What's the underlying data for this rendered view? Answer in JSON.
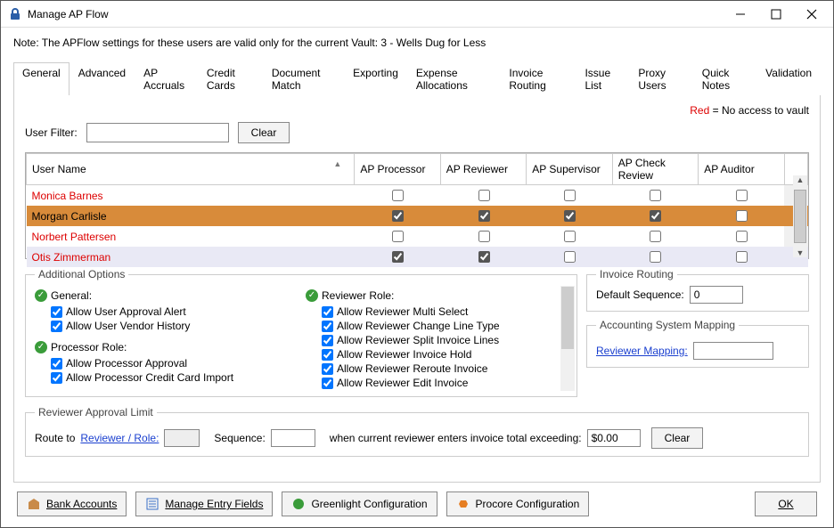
{
  "window": {
    "title": "Manage AP Flow"
  },
  "note": "Note:  The APFlow settings for these users are valid only for the current Vault: 3 - Wells Dug for Less",
  "redNote": {
    "red": "Red",
    "rest": " = No access to vault"
  },
  "tabs": [
    "General",
    "Advanced",
    "AP Accruals",
    "Credit Cards",
    "Document Match",
    "Exporting",
    "Expense Allocations",
    "Invoice Routing",
    "Issue List",
    "Proxy Users",
    "Quick Notes",
    "Validation"
  ],
  "activeTab": 0,
  "filter": {
    "label": "User Filter:",
    "value": "",
    "clear": "Clear"
  },
  "grid": {
    "columns": [
      "User Name",
      "AP Processor",
      "AP Reviewer",
      "AP Supervisor",
      "AP Check Review",
      "AP Auditor"
    ],
    "rows": [
      {
        "name": "Monica Barnes",
        "sel": false,
        "alt": false,
        "c": [
          false,
          false,
          false,
          false,
          false
        ]
      },
      {
        "name": "Morgan Carlisle",
        "sel": true,
        "alt": false,
        "c": [
          true,
          true,
          true,
          true,
          false
        ]
      },
      {
        "name": "Norbert Pattersen",
        "sel": false,
        "alt": false,
        "c": [
          false,
          false,
          false,
          false,
          false
        ]
      },
      {
        "name": "Otis Zimmerman",
        "sel": false,
        "alt": true,
        "c": [
          true,
          true,
          false,
          false,
          false
        ]
      }
    ]
  },
  "additional": {
    "legend": "Additional Options",
    "general": {
      "header": "General:",
      "items": [
        "Allow User Approval Alert",
        "Allow User Vendor History"
      ]
    },
    "processor": {
      "header": "Processor Role:",
      "items": [
        "Allow Processor Approval",
        "Allow Processor Credit Card Import"
      ]
    },
    "reviewer": {
      "header": "Reviewer Role:",
      "items": [
        "Allow Reviewer Multi Select",
        "Allow Reviewer Change Line Type",
        "Allow Reviewer Split Invoice Lines",
        "Allow Reviewer Invoice Hold",
        "Allow Reviewer Reroute Invoice",
        "Allow Reviewer Edit Invoice"
      ]
    }
  },
  "invoiceRouting": {
    "legend": "Invoice Routing",
    "label": "Default Sequence:",
    "value": "0"
  },
  "acctMap": {
    "legend": "Accounting System Mapping",
    "link": "Reviewer Mapping:",
    "value": ""
  },
  "reviewerLimit": {
    "legend": "Reviewer Approval Limit",
    "routeTo": "Route to",
    "link": "Reviewer / Role:",
    "role": "",
    "seqLabel": "Sequence:",
    "seq": "",
    "whenText": "when current reviewer enters invoice total exceeding:",
    "amount": "$0.00",
    "clear": "Clear"
  },
  "bottom": {
    "bank": "Bank Accounts",
    "entry": "Manage Entry Fields",
    "greenlight": "Greenlight Configuration",
    "procore": "Procore Configuration",
    "ok": "OK"
  }
}
